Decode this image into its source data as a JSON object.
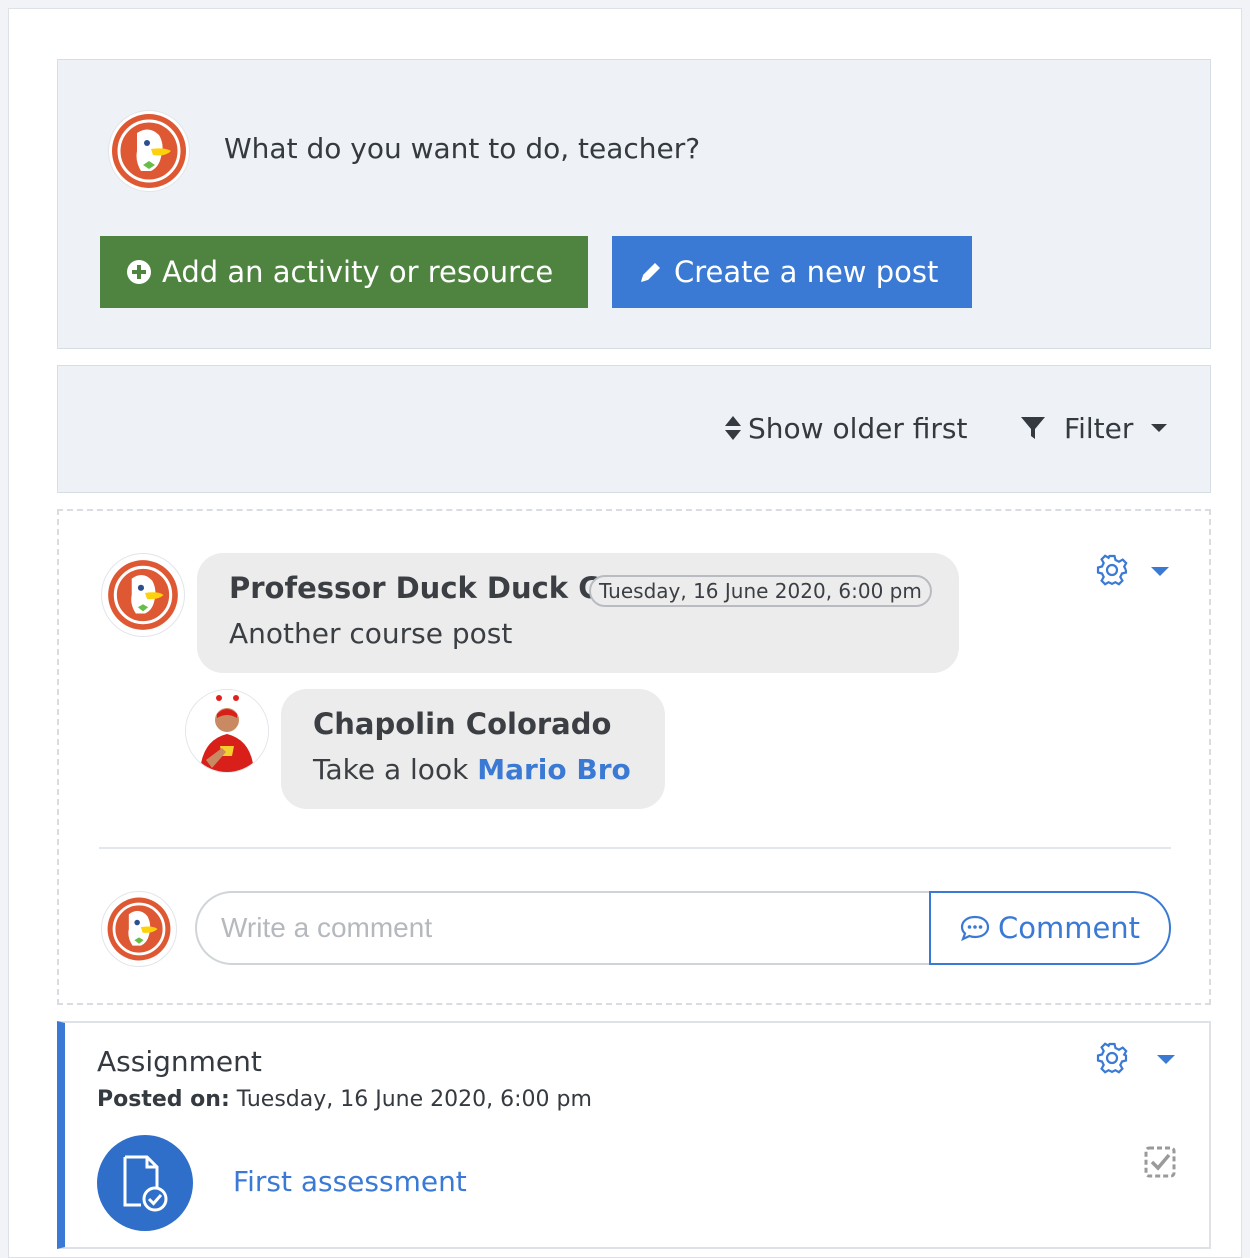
{
  "composer": {
    "question": "What do you want to do, teacher?",
    "add_activity_label": "Add an activity or resource",
    "create_post_label": "Create a new post"
  },
  "sortbar": {
    "sort_label": "Show older first",
    "filter_label": "Filter"
  },
  "post": {
    "author": "Professor Duck Duck Go",
    "date": "Tuesday, 16 June 2020, 6:00 pm",
    "text": "Another course post",
    "reply": {
      "author": "Chapolin Colorado",
      "text_prefix": "Take a look",
      "link_text": "Mario Bro"
    },
    "comment": {
      "placeholder": "Write a comment",
      "button_label": "Comment"
    }
  },
  "assignment": {
    "type": "Assignment",
    "posted_label": "Posted on:",
    "posted_date": "Tuesday, 16 June 2020, 6:00 pm",
    "title": "First assessment"
  },
  "colors": {
    "primary": "#3a7ad5",
    "success": "#4e8440",
    "panel": "#eef2f7",
    "bubble": "#ececec"
  },
  "icons": {
    "add": "plus-circle-icon",
    "create": "pencil-icon",
    "sort": "sort-icon",
    "filter": "filter-icon",
    "settings": "gear-icon",
    "comment": "comment-dots-icon",
    "assignment": "assignment-file-icon",
    "completion": "completion-checkbox-icon"
  }
}
